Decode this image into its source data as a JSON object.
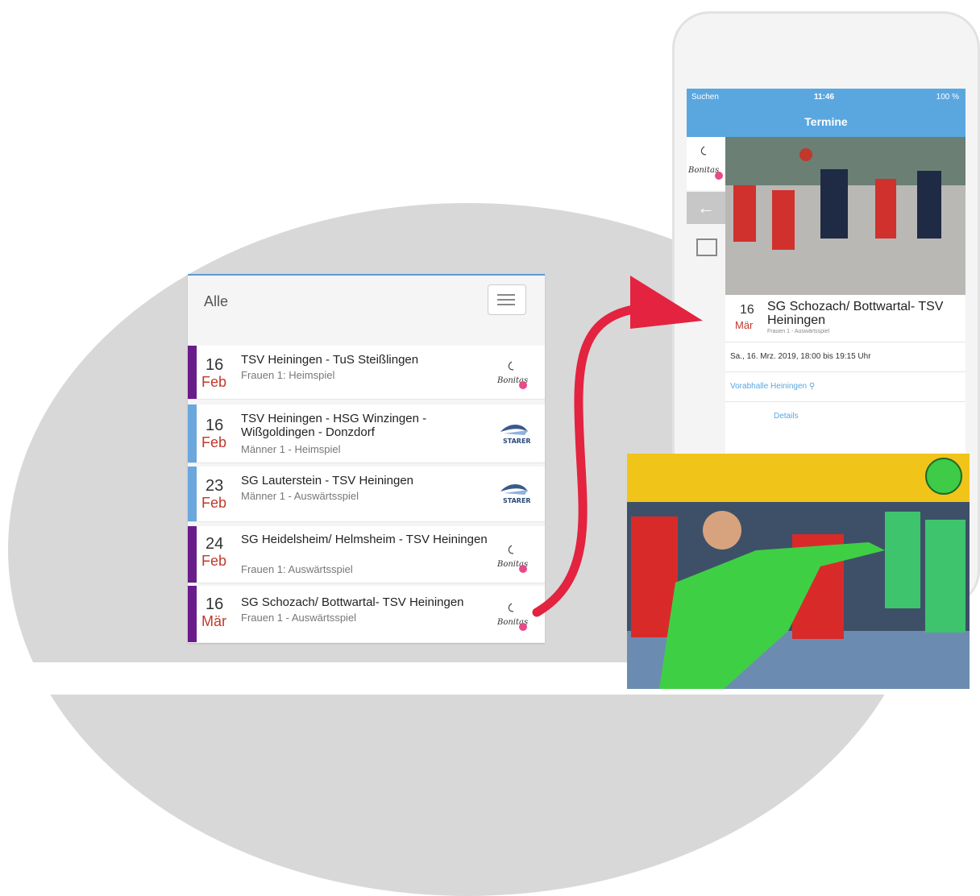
{
  "list": {
    "title": "Alle",
    "events": [
      {
        "day": "16",
        "month": "Feb",
        "title": "TSV Heiningen - TuS Steißlingen",
        "subtitle": "Frauen 1: Heimspiel",
        "bar": "#6a1b8a",
        "logo": "Bonitas"
      },
      {
        "day": "16",
        "month": "Feb",
        "title": "TSV Heiningen - HSG Winzingen - Wißgoldingen - Donzdorf",
        "subtitle": "Männer 1 - Heimspiel",
        "bar": "#6aa7dc",
        "logo": "STARER"
      },
      {
        "day": "23",
        "month": "Feb",
        "title": "SG Lauterstein - TSV Heiningen",
        "subtitle": "Männer 1 - Auswärtsspiel",
        "bar": "#6aa7dc",
        "logo": "STARER"
      },
      {
        "day": "24",
        "month": "Feb",
        "title": "SG Heidelsheim/ Helmsheim - TSV Heiningen",
        "subtitle": "Frauen 1: Auswärtsspiel",
        "bar": "#6a1b8a",
        "logo": "Bonitas"
      },
      {
        "day": "16",
        "month": "Mär",
        "title": "SG Schozach/ Bottwartal- TSV Heiningen",
        "subtitle": "Frauen 1 - Auswärtsspiel",
        "bar": "#6a1b8a",
        "logo": "Bonitas"
      }
    ]
  },
  "phone": {
    "status_left": "Suchen",
    "status_time": "11:46",
    "status_right": "100 %",
    "nav_title": "Termine",
    "event_day": "16",
    "event_month": "Mär",
    "event_title": "SG Schozach/ Bottwartal- TSV Heiningen",
    "event_subtitle": "Frauen 1 - Auswärtsspiel",
    "date_line": "Sa., 16. Mrz. 2019, 18:00 bis 19:15 Uhr",
    "venue": "Vorabhalle Heiningen",
    "details_label": "Details"
  },
  "colors": {
    "accent": "#5aa7e0",
    "arrow": "#e3233f",
    "month": "#c0392b"
  }
}
